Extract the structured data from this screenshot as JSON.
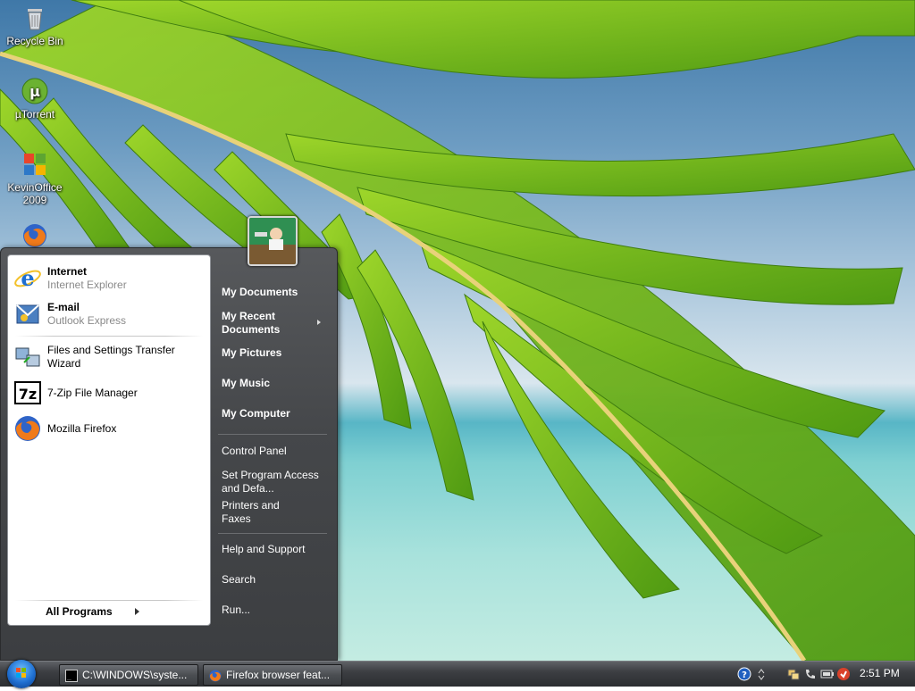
{
  "desktop": {
    "icons": [
      {
        "label": "Recycle Bin",
        "icon": "recycle-bin-icon"
      },
      {
        "label": "µTorrent",
        "icon": "utorrent-icon"
      },
      {
        "label": "KevinOffice 2009",
        "icon": "office-icon"
      },
      {
        "label": "",
        "icon": "firefox-icon"
      }
    ]
  },
  "start_menu": {
    "pinned": [
      {
        "title": "Internet",
        "subtitle": "Internet Explorer",
        "icon": "internet-explorer-icon"
      },
      {
        "title": "E-mail",
        "subtitle": "Outlook Express",
        "icon": "outlook-express-icon"
      }
    ],
    "recent": [
      {
        "title": "Files and Settings Transfer Wizard",
        "icon": "transfer-wizard-icon"
      },
      {
        "title": "7-Zip File Manager",
        "icon": "7zip-icon"
      },
      {
        "title": "Mozilla Firefox",
        "icon": "firefox-icon"
      }
    ],
    "all_programs": "All Programs",
    "right": {
      "my_documents": "My Documents",
      "my_recent_documents": "My Recent Documents",
      "my_pictures": "My Pictures",
      "my_music": "My Music",
      "my_computer": "My Computer",
      "control_panel": "Control Panel",
      "set_program_access": "Set Program Access and Defa...",
      "printers_and_faxes": "Printers and Faxes",
      "help_and_support": "Help and Support",
      "search": "Search",
      "run": "Run..."
    }
  },
  "taskbar": {
    "buttons": [
      {
        "label": "C:\\WINDOWS\\syste...",
        "icon": "command-prompt-icon"
      },
      {
        "label": "Firefox browser feat...",
        "icon": "firefox-icon"
      }
    ],
    "tray_icons": [
      "help-icon",
      "chevron-icon",
      "network-icon",
      "phone-icon",
      "battery-icon",
      "shield-icon"
    ],
    "clock": "2:51 PM"
  },
  "colors": {
    "taskbar": "#3d3f43",
    "start_menu": "#45474a",
    "accent": "#1f6fd1"
  }
}
